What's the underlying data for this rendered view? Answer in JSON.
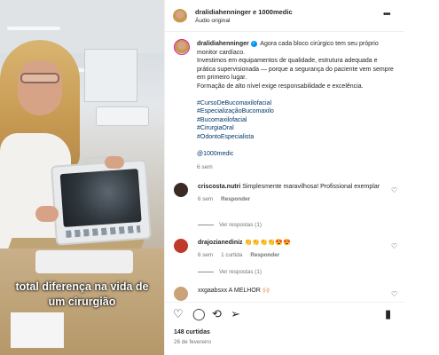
{
  "media": {
    "caption_line1": "total diferença na vida de",
    "caption_line2": "um cirurgião"
  },
  "header": {
    "users": "dralidiahenninger e 1000medic",
    "audio": "Áudio original",
    "more_icon": "more-horizontal-icon"
  },
  "post": {
    "username": "dralidiahenninger",
    "verified_icon": "verified-badge-icon",
    "text_line1": "Agora cada bloco cirúrgico tem seu próprio monitor cardíaco.",
    "text_line2": "Investimos em equipamentos de qualidade, estrutura adequada e prática supervisionada — porque a segurança do paciente vem sempre em primeiro lugar.",
    "text_line3": "Formação de alto nível exige responsabilidade e excelência.",
    "hashtags": [
      "#CursoDeBucomaxilofacial",
      "#EspecializaçãoBucomaxilo",
      "#Bucomaxilofacial",
      "#CirurgiaOral",
      "#OdontoEspecialista"
    ],
    "mention": "@1000medic",
    "time": "6 sem"
  },
  "comments": [
    {
      "username": "criscosta.nutri",
      "text": "Simplesmente maravilhosa! Profissional exemplar",
      "time": "6 sem",
      "likes": "",
      "reply": "Responder",
      "view_replies": "Ver respostas (1)",
      "avatar_color": "#3a2a24"
    },
    {
      "username": "drajozianediniz",
      "text": "👏👏👏👏😍😍",
      "time": "6 sem",
      "likes": "1 curtida",
      "reply": "Responder",
      "view_replies": "Ver respostas (1)",
      "avatar_color": "#c0392b"
    },
    {
      "username": "xxgaabsxx",
      "text": "A MELHOR 🙌🏻",
      "avatar_color": "#c9a27a"
    }
  ],
  "actions": {
    "like_icon": "heart-icon",
    "comment_icon": "comment-icon",
    "share_icon": "share-icon",
    "save_icon": "bookmark-icon",
    "likes_count": "148 curtidas",
    "date": "26 de fevereiro"
  }
}
